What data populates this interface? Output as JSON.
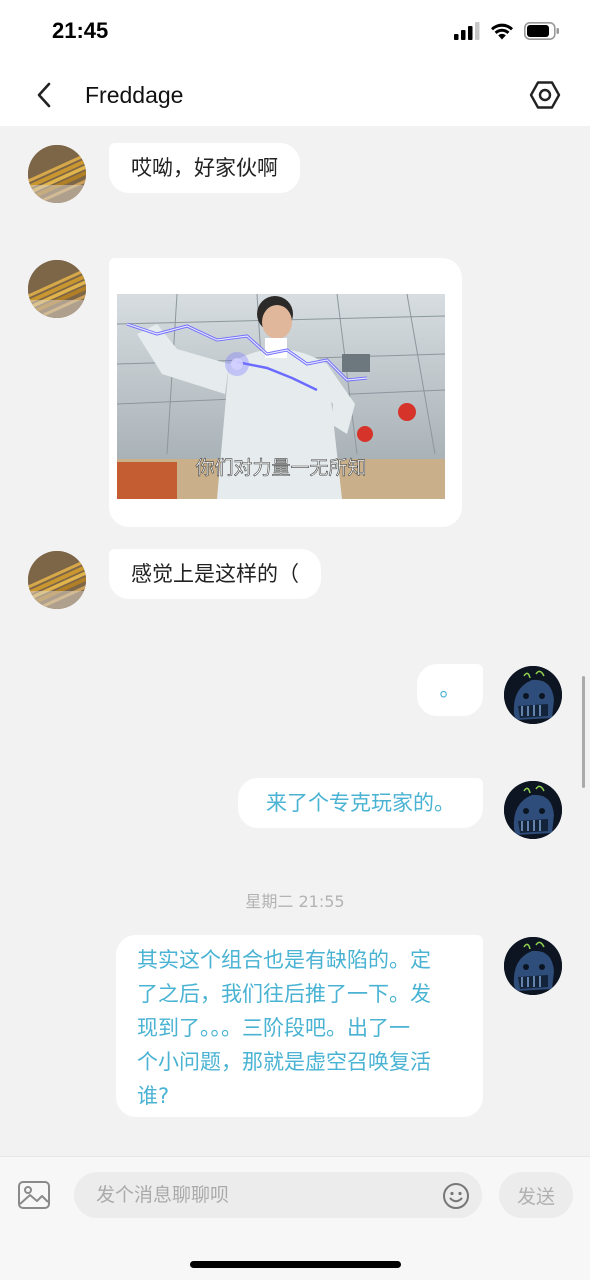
{
  "status_bar": {
    "time": "21:45"
  },
  "header": {
    "title": "Freddage"
  },
  "messages": [
    {
      "side": "left",
      "text": "哎呦，好家伙啊"
    },
    {
      "side": "left",
      "type": "image",
      "caption": "你们对力量一无所知"
    },
    {
      "side": "left",
      "text": "感觉上是这样的（"
    },
    {
      "side": "right",
      "text": "。"
    },
    {
      "side": "right",
      "text": "来了个专克玩家的。"
    },
    {
      "side": "right",
      "lines": [
        "其实这个组合也是有缺陷的。定",
        "了之后，我们往后推了一下。发",
        "现到了。。。三阶段吧。出了一",
        "个小问题，那就是虚空召唤复活",
        "谁?"
      ]
    }
  ],
  "timestamps": [
    "星期二 21:55"
  ],
  "input": {
    "placeholder": "发个消息聊聊呗",
    "send_label": "发送"
  },
  "colors": {
    "right_text": "#4ab3d3",
    "background": "#f2f2f2",
    "bubble": "#ffffff"
  }
}
